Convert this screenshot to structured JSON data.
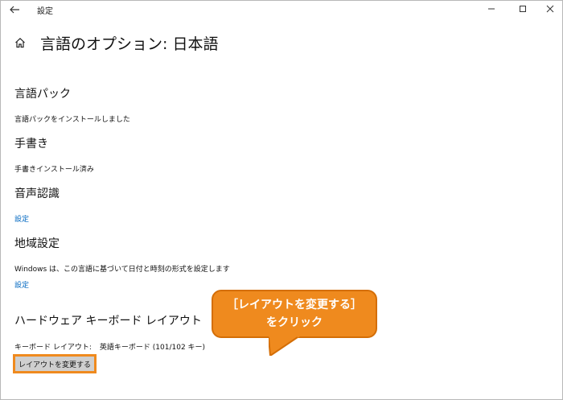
{
  "window": {
    "title": "設定"
  },
  "page": {
    "title": "言語のオプション: 日本語"
  },
  "sections": {
    "language_pack": {
      "heading": "言語パック",
      "status": "言語パックをインストールしました"
    },
    "handwriting": {
      "heading": "手書き",
      "status": "手書きインストール済み"
    },
    "speech": {
      "heading": "音声認識",
      "link": "設定"
    },
    "region": {
      "heading": "地域設定",
      "description": "Windows は、この言語に基づいて日付と時刻の形式を設定します",
      "link": "設定"
    },
    "keyboard": {
      "heading": "ハードウェア キーボード レイアウト",
      "layout_label": "キーボード レイアウト:",
      "layout_value": "英語キーボード (101/102 キー)",
      "change_button": "レイアウトを変更する"
    }
  },
  "callout": {
    "line1": "［レイアウトを変更する］",
    "line2": "をクリック"
  },
  "colors": {
    "link": "#0067c0",
    "callout": "#ef8a1e",
    "button_bg": "#cfcfcf"
  },
  "icons": {
    "back": "back-arrow-icon",
    "home": "home-icon",
    "minimize": "minimize-icon",
    "maximize": "maximize-icon",
    "close": "close-icon"
  }
}
